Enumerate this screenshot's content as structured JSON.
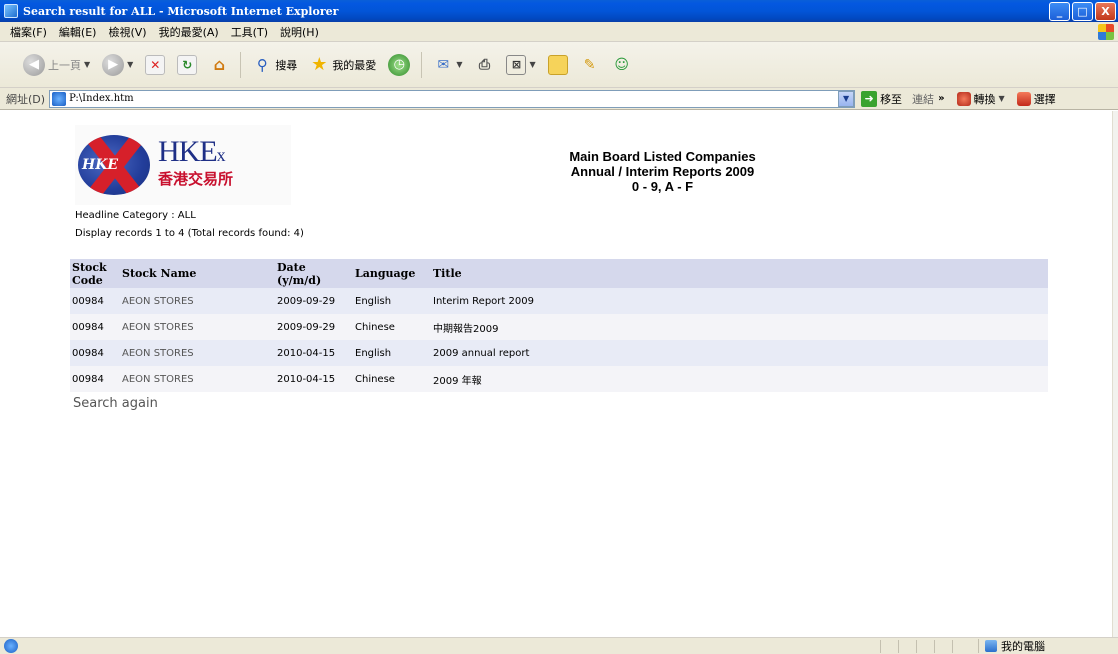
{
  "window": {
    "title": "Search result for ALL - Microsoft Internet Explorer",
    "buttons": [
      "_",
      "□",
      "X"
    ]
  },
  "menu": [
    "檔案(F)",
    "編輯(E)",
    "檢視(V)",
    "我的最愛(A)",
    "工具(T)",
    "說明(H)"
  ],
  "toolbar": {
    "back_label": "上一頁",
    "search_label": "搜尋",
    "favorites_label": "我的最愛"
  },
  "address": {
    "label": "網址(D)",
    "value": "P:\\Index.htm",
    "go_label": "移至",
    "links_label": "連結",
    "convert_label": "轉換",
    "select_label": "選擇"
  },
  "page": {
    "logo": {
      "emblem_text": "HKE",
      "brand_main": "HKE",
      "brand_suffix": "x",
      "brand_cn": "香港交易所"
    },
    "title_line1": "Main Board Listed Companies",
    "title_line2": "Annual / Interim Reports 2009",
    "title_line3": "0 - 9, A - F",
    "headline_category": "Headline Category : ALL",
    "display_records": "Display records 1 to 4 (Total records found: 4)",
    "table": {
      "headers": {
        "stock_code": "Stock Code",
        "stock_name": "Stock Name",
        "date": "Date (y/m/d)",
        "language": "Language",
        "title": "Title"
      },
      "rows": [
        {
          "code": "00984",
          "name": "AEON STORES",
          "date": "2009-09-29",
          "language": "English",
          "title": "Interim Report 2009"
        },
        {
          "code": "00984",
          "name": "AEON STORES",
          "date": "2009-09-29",
          "language": "Chinese",
          "title": "中期報告2009"
        },
        {
          "code": "00984",
          "name": "AEON STORES",
          "date": "2010-04-15",
          "language": "English",
          "title": "2009 annual report"
        },
        {
          "code": "00984",
          "name": "AEON STORES",
          "date": "2010-04-15",
          "language": "Chinese",
          "title": "2009 年報"
        }
      ]
    },
    "search_again": "Search again"
  },
  "status": {
    "zone": "我的電腦"
  }
}
